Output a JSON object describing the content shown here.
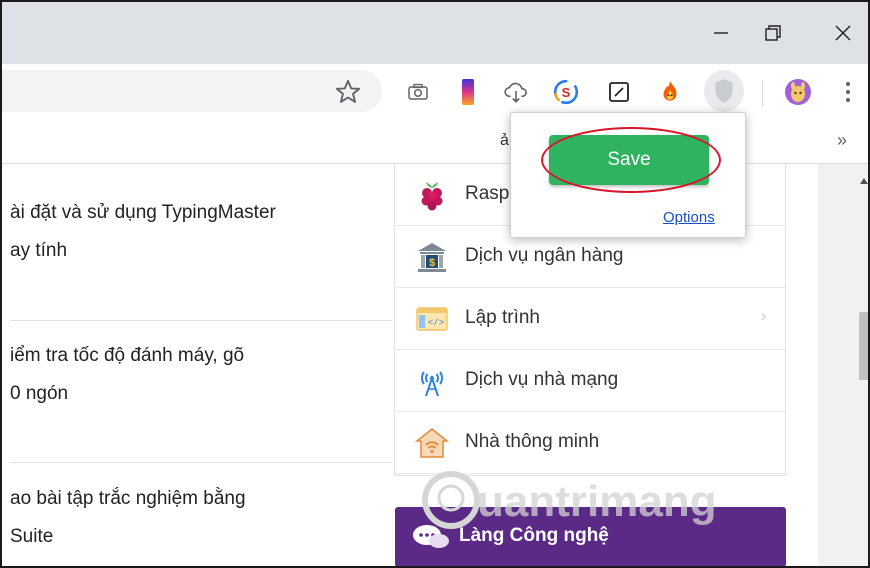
{
  "window": {
    "controls": {
      "minimize": "minimize-icon",
      "maximize": "restore-icon",
      "close": "close-icon"
    }
  },
  "toolbar": {
    "extensions": [
      "camera-icon",
      "gradient-color-icon",
      "cloud-download-icon",
      "s-badge-icon",
      "edit-square-icon",
      "fire-icon",
      "shield-extension-icon",
      "profile-avatar-icon",
      "more-menu-icon"
    ]
  },
  "bookmarks": {
    "fragment": "ả",
    "overflow": "»"
  },
  "popup": {
    "save_label": "Save",
    "options_label": "Options",
    "highlight_color": "#d8162b",
    "save_color": "#2fb360"
  },
  "articles": [
    {
      "line1": "ài đặt và sử dụng TypingMaster",
      "line2": "ay tính"
    },
    {
      "line1": "iểm tra tốc độ đánh máy, gõ",
      "line2": "0 ngón"
    },
    {
      "line1": "ao bài tập trắc nghiệm bằng",
      "line2": " Suite"
    }
  ],
  "menu": {
    "items": [
      {
        "label": "Rasp",
        "icon": "raspberry-icon"
      },
      {
        "label": "Dịch vụ ngân hàng",
        "icon": "bank-icon"
      },
      {
        "label": "Lập trình",
        "icon": "code-window-icon",
        "has_submenu": true
      },
      {
        "label": "Dịch vụ nhà mạng",
        "icon": "antenna-icon"
      },
      {
        "label": "Nhà thông minh",
        "icon": "smart-home-icon"
      }
    ]
  },
  "banner": {
    "label": "Làng Công nghệ",
    "color": "#5b2a86"
  },
  "watermark": {
    "text": "uantrimang"
  }
}
